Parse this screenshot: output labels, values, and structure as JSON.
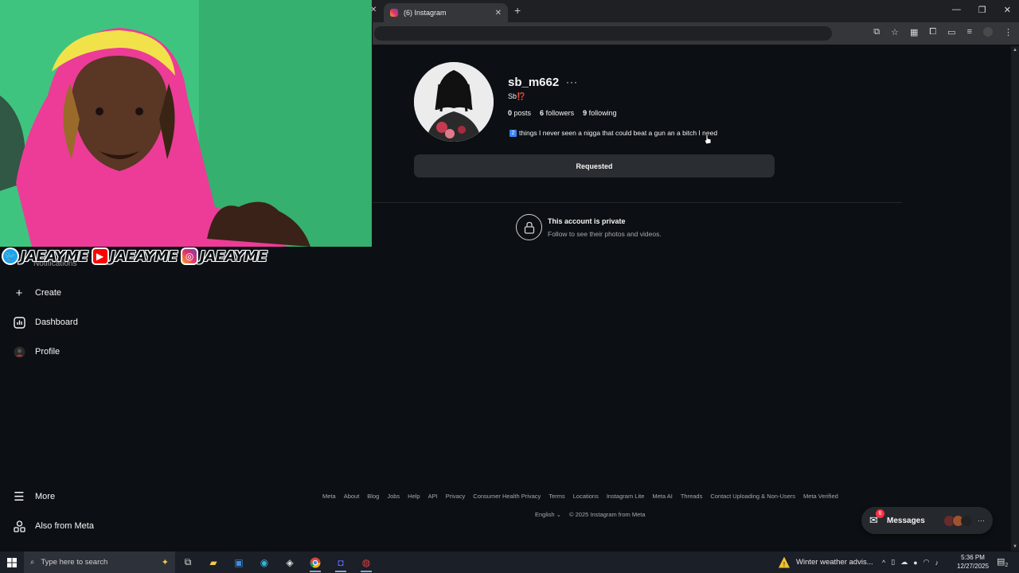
{
  "browser": {
    "tab_title": "(6) Instagram",
    "new_tab_symbol": "+",
    "close_symbol": "✕"
  },
  "overlay": {
    "handles": [
      {
        "platform": "twitter",
        "name": "JAEAYME",
        "color": "#1da1f2"
      },
      {
        "platform": "youtube",
        "name": "JAEAYME",
        "color": "#ff0000"
      },
      {
        "platform": "instagram",
        "name": "JAEAYME",
        "color": "#c13584"
      }
    ]
  },
  "sidebar": {
    "hidden_label": "Notifications",
    "items": [
      {
        "label": "Create",
        "icon": "plus-icon"
      },
      {
        "label": "Dashboard",
        "icon": "dashboard-icon"
      },
      {
        "label": "Profile",
        "icon": "profile-avatar-icon"
      }
    ],
    "bottom": [
      {
        "label": "More",
        "icon": "menu-icon"
      },
      {
        "label": "Also from Meta",
        "icon": "meta-apps-icon"
      }
    ]
  },
  "profile": {
    "username": "sb_m662",
    "more_symbol": "···",
    "full_name": "Sb",
    "full_name_emoji": "⁉️",
    "posts_count": "0",
    "posts_label": "posts",
    "followers_count": "6",
    "followers_label": "followers",
    "following_count": "9",
    "following_label": "following",
    "bio_number": "2",
    "bio": "things I never seen a nigga that could beat a gun an a bitch I need",
    "follow_button": "Requested",
    "private_title": "This account is private",
    "private_subtitle": "Follow to see their photos and videos."
  },
  "footer": {
    "links": [
      "Meta",
      "About",
      "Blog",
      "Jobs",
      "Help",
      "API",
      "Privacy",
      "Consumer Health Privacy",
      "Terms",
      "Locations",
      "Instagram Lite",
      "Meta AI",
      "Threads",
      "Contact Uploading & Non-Users",
      "Meta Verified"
    ],
    "language": "English",
    "copyright": "© 2025 Instagram from Meta"
  },
  "messages": {
    "label": "Messages",
    "badge": "6",
    "avatar_colors": [
      "#6b2a2a",
      "#a0522d",
      "#222222"
    ]
  },
  "taskbar": {
    "search_placeholder": "Type here to search",
    "weather": "Winter weather advis...",
    "time": "5:36 PM",
    "date": "12/27/2025",
    "notification_count": "2"
  }
}
